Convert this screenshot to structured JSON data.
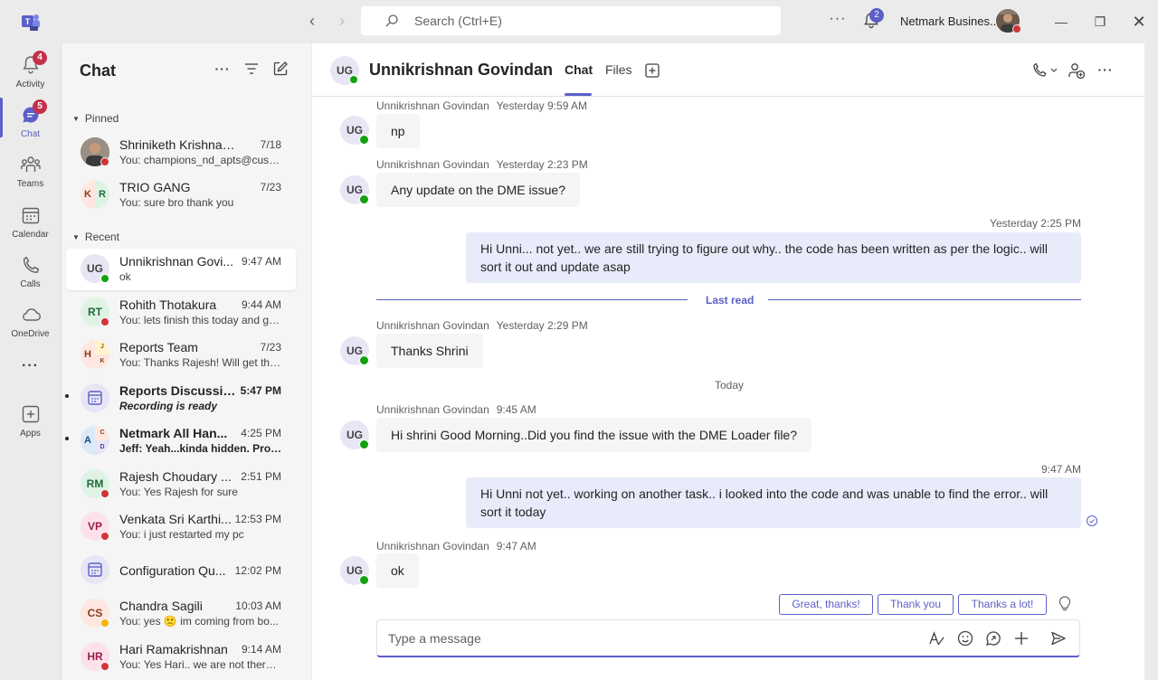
{
  "topbar": {
    "search_placeholder": "Search (Ctrl+E)",
    "more_label": "···",
    "notifications_count": "2",
    "org_name": "Netmark Busines...",
    "accent": "#5b5fc7"
  },
  "rail": {
    "items": [
      {
        "label": "Activity",
        "icon": "bell-icon",
        "badge": "4"
      },
      {
        "label": "Chat",
        "icon": "chat-icon",
        "badge": "5"
      },
      {
        "label": "Teams",
        "icon": "teams-icon"
      },
      {
        "label": "Calendar",
        "icon": "calendar-icon"
      },
      {
        "label": "Calls",
        "icon": "phone-icon"
      },
      {
        "label": "OneDrive",
        "icon": "cloud-icon"
      },
      {
        "label": "···",
        "icon": "more-icon"
      },
      {
        "label": "Apps",
        "icon": "add-apps-icon"
      }
    ]
  },
  "chatlist": {
    "title": "Chat",
    "pinned_label": "Pinned",
    "recent_label": "Recent",
    "pinned": [
      {
        "name": "Shriniketh Krishnan (Y...",
        "time": "7/18",
        "preview": "You: champions_nd_apts@cush...",
        "initials": "",
        "status": "busy"
      },
      {
        "name": "TRIO GANG",
        "time": "7/23",
        "preview": "You: sure bro thank you",
        "initials": "K R",
        "status": ""
      }
    ],
    "recent": [
      {
        "name": "Unnikrishnan Govi...",
        "time": "9:47 AM",
        "preview": "ok",
        "initials": "UG",
        "status": "available"
      },
      {
        "name": "Rohith Thotakura",
        "time": "9:44 AM",
        "preview": "You: lets finish this today and ge...",
        "initials": "RT",
        "status": "busy"
      },
      {
        "name": "Reports Team",
        "time": "7/23",
        "preview": "You: Thanks Rajesh! Will get the ...",
        "initials": "H",
        "status": ""
      },
      {
        "name": "Reports Discussion",
        "time": "5:47 PM",
        "preview": "Recording is ready",
        "initials": "",
        "status": ""
      },
      {
        "name": "Netmark All Han...",
        "time": "4:25 PM",
        "preview": "Jeff: Yeah...kinda hidden.  Provi...",
        "initials": "A",
        "status": ""
      },
      {
        "name": "Rajesh Choudary ...",
        "time": "2:51 PM",
        "preview": "You: Yes Rajesh for sure",
        "initials": "RM",
        "status": "busy"
      },
      {
        "name": "Venkata Sri Karthi...",
        "time": "12:53 PM",
        "preview": "You: i just restarted my pc",
        "initials": "VP",
        "status": "busy"
      },
      {
        "name": "Configuration Qu...",
        "time": "12:02 PM",
        "preview": "",
        "initials": "",
        "status": ""
      },
      {
        "name": "Chandra Sagili",
        "time": "10:03 AM",
        "preview": "You: yes 🙁 im coming from bo...",
        "initials": "CS",
        "status": "away"
      },
      {
        "name": "Hari Ramakrishnan",
        "time": "9:14 AM",
        "preview": "You: Yes Hari.. we are not there y...",
        "initials": "HR",
        "status": "busy"
      }
    ]
  },
  "conversation": {
    "contact_initials": "UG",
    "contact_name": "Unnikrishnan Govindan",
    "tabs": [
      "Chat",
      "Files"
    ],
    "last_read_label": "Last read",
    "today_label": "Today",
    "messages": [
      {
        "author": "Unnikrishnan Govindan",
        "time": "Yesterday 9:59 AM",
        "text": "np"
      },
      {
        "author": "Unnikrishnan Govindan",
        "time": "Yesterday 2:23 PM",
        "text": "Any update on the DME issue?"
      },
      {
        "author": "me",
        "time": "Yesterday 2:25 PM",
        "text": "Hi Unni... not yet.. we are still trying to figure out why.. the code has been written as per the logic.. will sort it out and update asap"
      },
      {
        "author": "Unnikrishnan Govindan",
        "time": "Yesterday 2:29 PM",
        "text": "Thanks Shrini"
      },
      {
        "author": "Unnikrishnan Govindan",
        "time": "9:45 AM",
        "text": "Hi shrini Good Morning..Did you find the issue with the DME Loader file?"
      },
      {
        "author": "me",
        "time": "9:47 AM",
        "text": "Hi Unni not yet.. working on another task.. i looked into the code and was unable to find the error.. will sort it today"
      },
      {
        "author": "Unnikrishnan Govindan",
        "time": "9:47 AM",
        "text": "ok"
      }
    ],
    "suggestions": [
      "Great, thanks!",
      "Thank you",
      "Thanks a lot!"
    ],
    "composer_placeholder": "Type a message"
  }
}
